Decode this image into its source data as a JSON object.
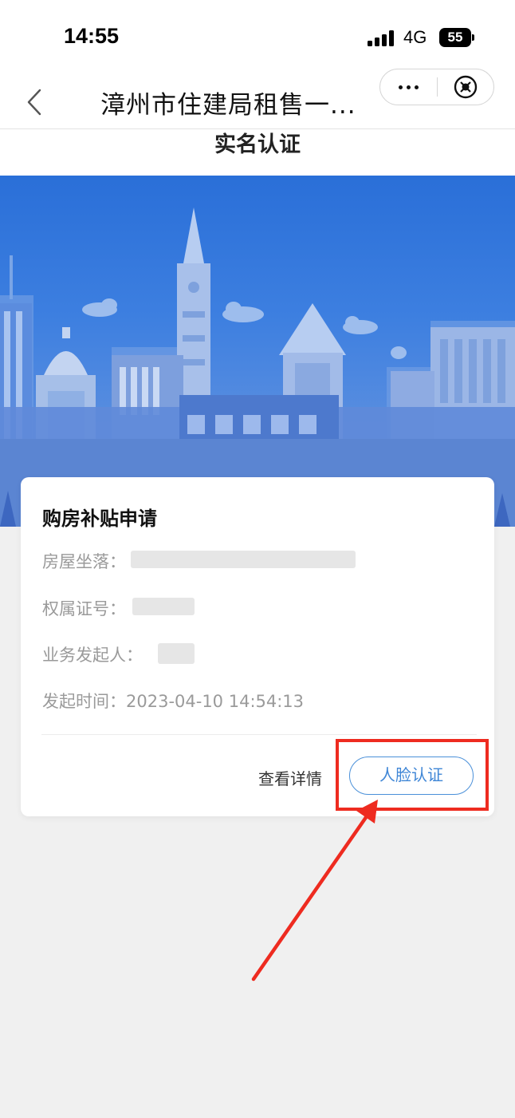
{
  "status_bar": {
    "time": "14:55",
    "network": "4G",
    "battery": "55"
  },
  "nav": {
    "title": "漳州市住建局租售一...",
    "back_icon": "chevron-left-icon",
    "more_icon": "more-dots-icon",
    "close_icon": "close-circle-icon"
  },
  "page": {
    "title": "实名认证"
  },
  "card": {
    "title": "购房补贴申请",
    "fields": [
      {
        "label": "房屋坐落：",
        "value": ""
      },
      {
        "label": "权属证号：",
        "value": ""
      },
      {
        "label": "业务发起人：",
        "value": ""
      },
      {
        "label": "发起时间：",
        "value": "2023-04-10 14:54:13"
      }
    ],
    "detail_link": "查看详情",
    "face_button": "人脸认证"
  },
  "colors": {
    "accent": "#4a90d9",
    "highlight": "#ee2b20",
    "banner": "#2a6fd8",
    "background": "#f0f0f0"
  }
}
